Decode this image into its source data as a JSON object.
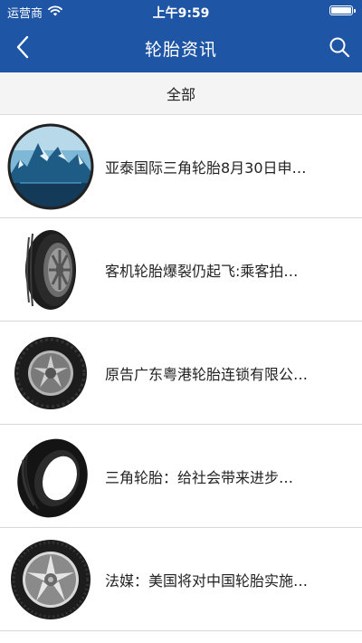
{
  "status_bar": {
    "carrier": "运营商",
    "time": "上午9:59",
    "wifi_icon": "wifi-icon",
    "battery_icon": "battery-icon",
    "battery_level": 1.0
  },
  "nav": {
    "title": "轮胎资讯",
    "back_icon": "chevron-left-icon",
    "search_icon": "search-icon"
  },
  "tabs": [
    {
      "label": "全部",
      "selected": true
    }
  ],
  "news": [
    {
      "title": "亚泰国际三角轮胎8月30日申…",
      "thumbnail": "prado-mountain-logo"
    },
    {
      "title": "客机轮胎爆裂仍起飞:乘客拍…",
      "thumbnail": "tire-side-view"
    },
    {
      "title": "原告广东粤港轮胎连锁有限公…",
      "thumbnail": "tire-alloy-wheel"
    },
    {
      "title": "三角轮胎：给社会带来进步…",
      "thumbnail": "tire-angled"
    },
    {
      "title": "法媒：美国将对中国轮胎实施…",
      "thumbnail": "tire-chrome-wheel"
    }
  ],
  "colors": {
    "header_bg": "#1f55a5",
    "tab_bg": "#f4f4f4",
    "divider": "#d8d8d8"
  }
}
